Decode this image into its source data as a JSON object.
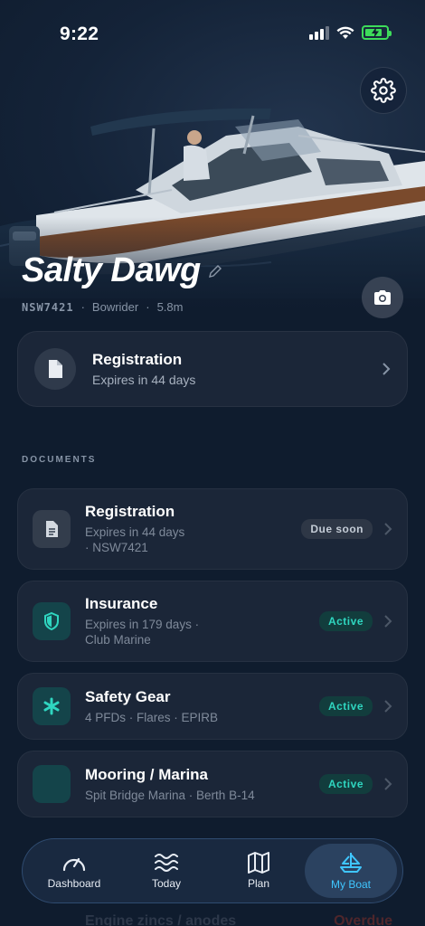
{
  "status": {
    "time": "9:22"
  },
  "boat": {
    "name": "Salty Dawg",
    "registration": "NSW7421",
    "type": "Bowrider",
    "length": "5.8m"
  },
  "registration_card": {
    "title": "Registration",
    "subtitle": "Expires in 44 days"
  },
  "documents": {
    "section_label": "DOCUMENTS",
    "items": [
      {
        "title": "Registration",
        "subtitle": "Expires in 44 days",
        "subtitle2": "· NSW7421",
        "badge": "Due soon"
      },
      {
        "title": "Insurance",
        "subtitle": "Expires in 179 days ·",
        "subtitle2": "Club Marine",
        "badge": "Active"
      },
      {
        "title": "Safety Gear",
        "subtitle": "4 PFDs · Flares · EPIRB",
        "badge": "Active"
      },
      {
        "title": "Mooring / Marina",
        "subtitle": "Spit Bridge Marina · Berth B-14",
        "badge": "Active"
      }
    ]
  },
  "nav": {
    "items": [
      {
        "label": "Dashboard"
      },
      {
        "label": "Today"
      },
      {
        "label": "Plan"
      },
      {
        "label": "My Boat"
      }
    ]
  },
  "ghost": {
    "left": "Engine zincs / anodes",
    "right": "Overdue"
  },
  "colors": {
    "accent": "#3fc6ff",
    "active_badge": "#2fd6c0",
    "card": "#1b2638",
    "background": "#0f1c2e"
  },
  "icons": [
    "gear-icon",
    "camera-icon",
    "pencil-icon",
    "document-icon",
    "shield-icon",
    "asterisk-icon",
    "gauge-icon",
    "waves-icon",
    "map-icon",
    "sailboat-icon"
  ]
}
